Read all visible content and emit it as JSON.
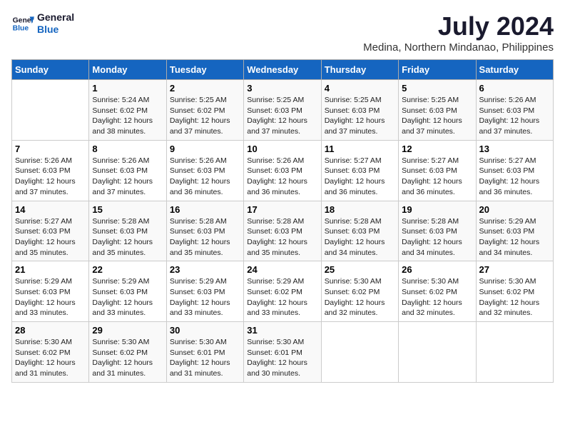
{
  "header": {
    "logo_line1": "General",
    "logo_line2": "Blue",
    "month_year": "July 2024",
    "location": "Medina, Northern Mindanao, Philippines"
  },
  "weekdays": [
    "Sunday",
    "Monday",
    "Tuesday",
    "Wednesday",
    "Thursday",
    "Friday",
    "Saturday"
  ],
  "weeks": [
    [
      {
        "day": "",
        "info": ""
      },
      {
        "day": "1",
        "info": "Sunrise: 5:24 AM\nSunset: 6:02 PM\nDaylight: 12 hours\nand 38 minutes."
      },
      {
        "day": "2",
        "info": "Sunrise: 5:25 AM\nSunset: 6:02 PM\nDaylight: 12 hours\nand 37 minutes."
      },
      {
        "day": "3",
        "info": "Sunrise: 5:25 AM\nSunset: 6:03 PM\nDaylight: 12 hours\nand 37 minutes."
      },
      {
        "day": "4",
        "info": "Sunrise: 5:25 AM\nSunset: 6:03 PM\nDaylight: 12 hours\nand 37 minutes."
      },
      {
        "day": "5",
        "info": "Sunrise: 5:25 AM\nSunset: 6:03 PM\nDaylight: 12 hours\nand 37 minutes."
      },
      {
        "day": "6",
        "info": "Sunrise: 5:26 AM\nSunset: 6:03 PM\nDaylight: 12 hours\nand 37 minutes."
      }
    ],
    [
      {
        "day": "7",
        "info": "Sunrise: 5:26 AM\nSunset: 6:03 PM\nDaylight: 12 hours\nand 37 minutes."
      },
      {
        "day": "8",
        "info": "Sunrise: 5:26 AM\nSunset: 6:03 PM\nDaylight: 12 hours\nand 37 minutes."
      },
      {
        "day": "9",
        "info": "Sunrise: 5:26 AM\nSunset: 6:03 PM\nDaylight: 12 hours\nand 36 minutes."
      },
      {
        "day": "10",
        "info": "Sunrise: 5:26 AM\nSunset: 6:03 PM\nDaylight: 12 hours\nand 36 minutes."
      },
      {
        "day": "11",
        "info": "Sunrise: 5:27 AM\nSunset: 6:03 PM\nDaylight: 12 hours\nand 36 minutes."
      },
      {
        "day": "12",
        "info": "Sunrise: 5:27 AM\nSunset: 6:03 PM\nDaylight: 12 hours\nand 36 minutes."
      },
      {
        "day": "13",
        "info": "Sunrise: 5:27 AM\nSunset: 6:03 PM\nDaylight: 12 hours\nand 36 minutes."
      }
    ],
    [
      {
        "day": "14",
        "info": "Sunrise: 5:27 AM\nSunset: 6:03 PM\nDaylight: 12 hours\nand 35 minutes."
      },
      {
        "day": "15",
        "info": "Sunrise: 5:28 AM\nSunset: 6:03 PM\nDaylight: 12 hours\nand 35 minutes."
      },
      {
        "day": "16",
        "info": "Sunrise: 5:28 AM\nSunset: 6:03 PM\nDaylight: 12 hours\nand 35 minutes."
      },
      {
        "day": "17",
        "info": "Sunrise: 5:28 AM\nSunset: 6:03 PM\nDaylight: 12 hours\nand 35 minutes."
      },
      {
        "day": "18",
        "info": "Sunrise: 5:28 AM\nSunset: 6:03 PM\nDaylight: 12 hours\nand 34 minutes."
      },
      {
        "day": "19",
        "info": "Sunrise: 5:28 AM\nSunset: 6:03 PM\nDaylight: 12 hours\nand 34 minutes."
      },
      {
        "day": "20",
        "info": "Sunrise: 5:29 AM\nSunset: 6:03 PM\nDaylight: 12 hours\nand 34 minutes."
      }
    ],
    [
      {
        "day": "21",
        "info": "Sunrise: 5:29 AM\nSunset: 6:03 PM\nDaylight: 12 hours\nand 33 minutes."
      },
      {
        "day": "22",
        "info": "Sunrise: 5:29 AM\nSunset: 6:03 PM\nDaylight: 12 hours\nand 33 minutes."
      },
      {
        "day": "23",
        "info": "Sunrise: 5:29 AM\nSunset: 6:03 PM\nDaylight: 12 hours\nand 33 minutes."
      },
      {
        "day": "24",
        "info": "Sunrise: 5:29 AM\nSunset: 6:02 PM\nDaylight: 12 hours\nand 33 minutes."
      },
      {
        "day": "25",
        "info": "Sunrise: 5:30 AM\nSunset: 6:02 PM\nDaylight: 12 hours\nand 32 minutes."
      },
      {
        "day": "26",
        "info": "Sunrise: 5:30 AM\nSunset: 6:02 PM\nDaylight: 12 hours\nand 32 minutes."
      },
      {
        "day": "27",
        "info": "Sunrise: 5:30 AM\nSunset: 6:02 PM\nDaylight: 12 hours\nand 32 minutes."
      }
    ],
    [
      {
        "day": "28",
        "info": "Sunrise: 5:30 AM\nSunset: 6:02 PM\nDaylight: 12 hours\nand 31 minutes."
      },
      {
        "day": "29",
        "info": "Sunrise: 5:30 AM\nSunset: 6:02 PM\nDaylight: 12 hours\nand 31 minutes."
      },
      {
        "day": "30",
        "info": "Sunrise: 5:30 AM\nSunset: 6:01 PM\nDaylight: 12 hours\nand 31 minutes."
      },
      {
        "day": "31",
        "info": "Sunrise: 5:30 AM\nSunset: 6:01 PM\nDaylight: 12 hours\nand 30 minutes."
      },
      {
        "day": "",
        "info": ""
      },
      {
        "day": "",
        "info": ""
      },
      {
        "day": "",
        "info": ""
      }
    ]
  ]
}
